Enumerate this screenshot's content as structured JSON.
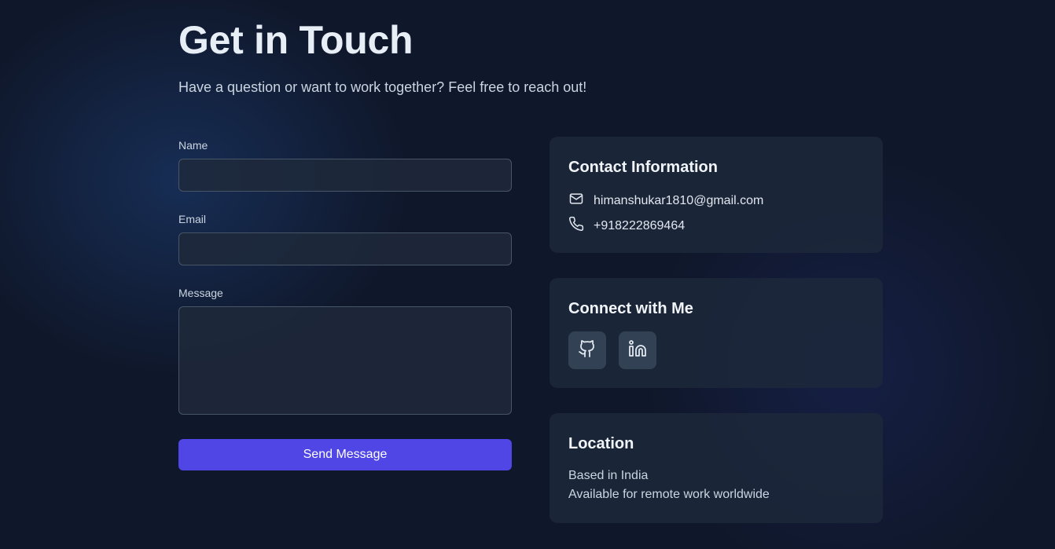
{
  "header": {
    "title": "Get in Touch",
    "subtitle": "Have a question or want to work together? Feel free to reach out!"
  },
  "form": {
    "name_label": "Name",
    "name_value": "",
    "email_label": "Email",
    "email_value": "",
    "message_label": "Message",
    "message_value": "",
    "submit_label": "Send Message"
  },
  "contact": {
    "title": "Contact Information",
    "email": "himanshukar1810@gmail.com",
    "email_icon": "mail-icon",
    "phone": "+918222869464",
    "phone_icon": "phone-icon"
  },
  "connect": {
    "title": "Connect with Me",
    "links": [
      {
        "icon": "github-icon"
      },
      {
        "icon": "linkedin-icon"
      }
    ]
  },
  "location": {
    "title": "Location",
    "line1": "Based in India",
    "line2": "Available for remote work worldwide"
  },
  "colors": {
    "background": "#0f172a",
    "card": "#1e293b",
    "accent": "#4f46e5",
    "social_button": "#334155"
  }
}
